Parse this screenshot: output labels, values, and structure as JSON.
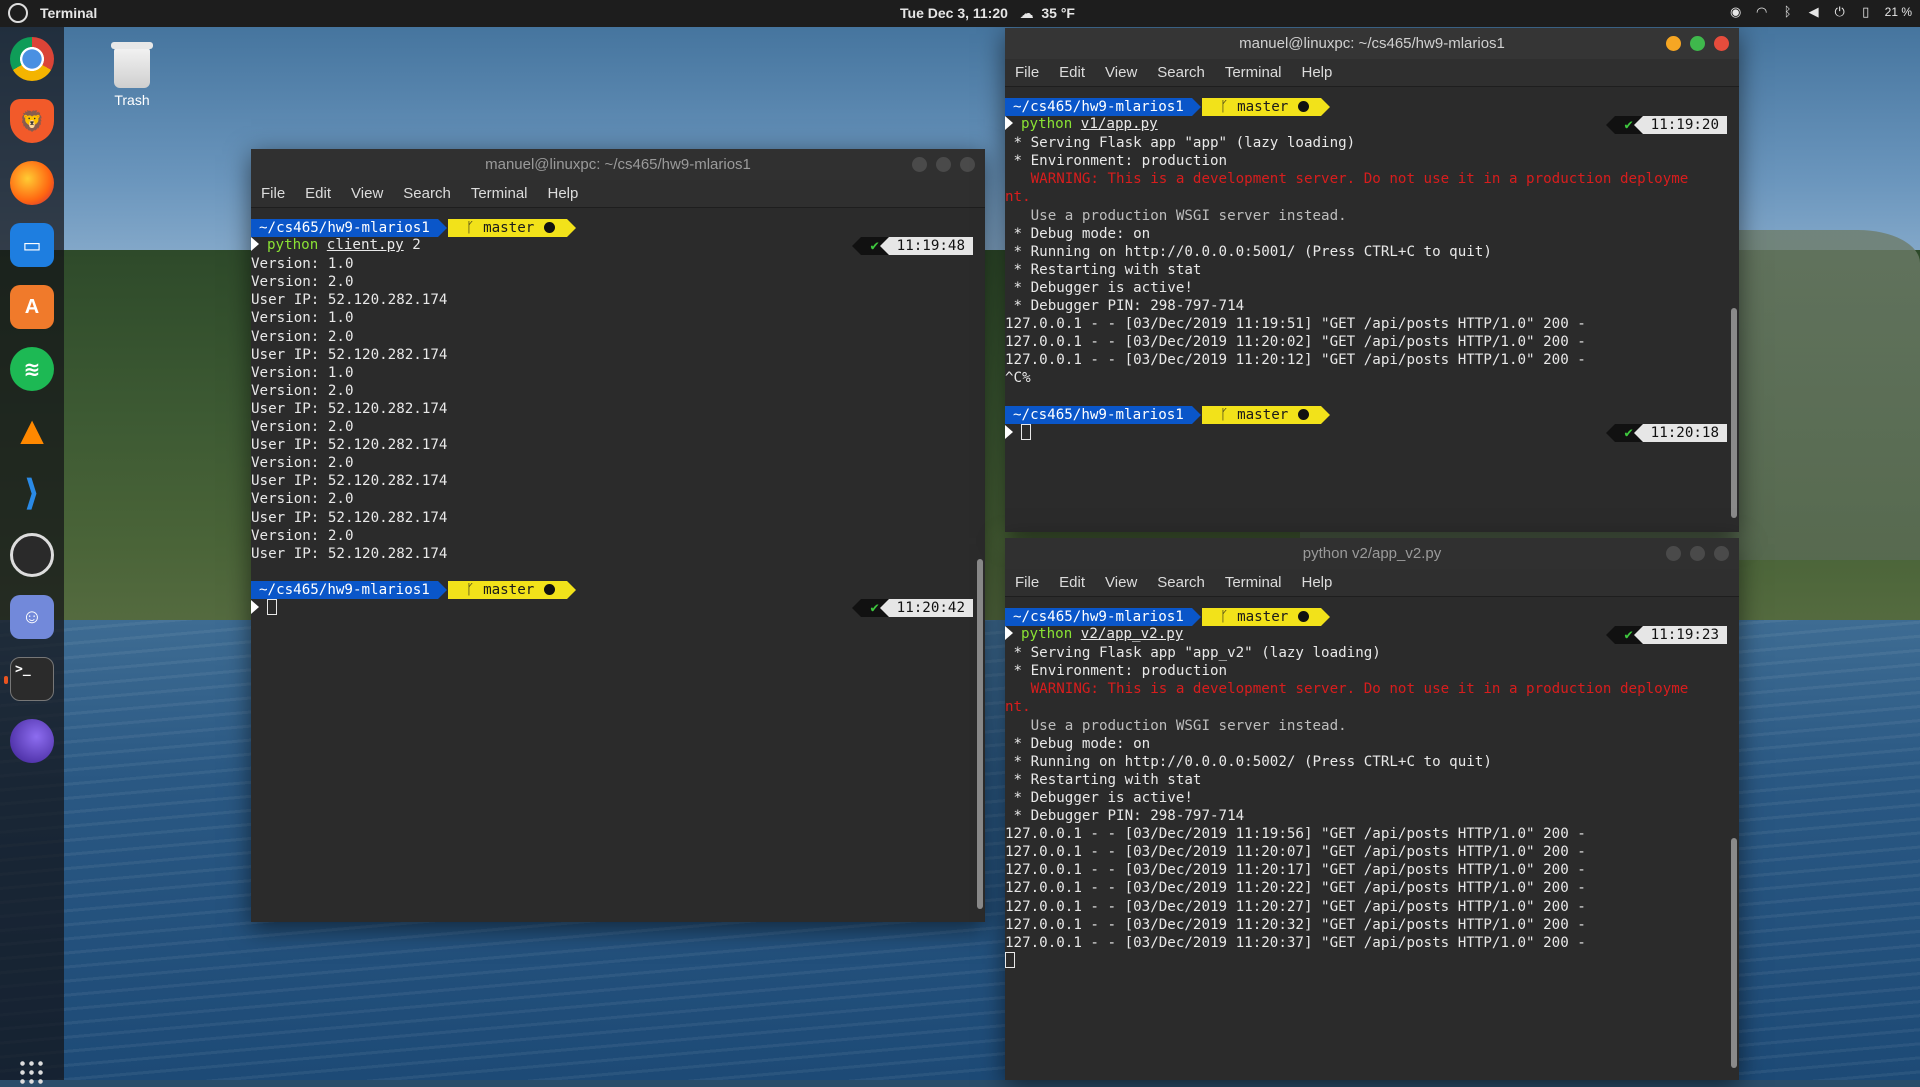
{
  "topbar": {
    "app_name": "Terminal",
    "datetime": "Tue Dec  3, 11:20",
    "weather": "35 °F",
    "battery": "21 %"
  },
  "dock": {
    "items": [
      "Chrome",
      "Brave",
      "Firefox",
      "Files",
      "Software",
      "Spotify",
      "VLC",
      "VS Code",
      "OBS",
      "Discord",
      "Terminal",
      "Stacer"
    ]
  },
  "desktop": {
    "trash_label": "Trash"
  },
  "menu": [
    "File",
    "Edit",
    "View",
    "Search",
    "Terminal",
    "Help"
  ],
  "win1": {
    "title": "manuel@linuxpc: ~/cs465/hw9-mlarios1",
    "prompt1": {
      "dir": "~/cs465/hw9-mlarios1",
      "branch": "master",
      "cmd": "python",
      "arg": "client.py",
      "rest": " 2",
      "time": "11:19:48"
    },
    "output": [
      "Version: 1.0",
      "Version: 2.0",
      "User IP: 52.120.282.174",
      "Version: 1.0",
      "Version: 2.0",
      "User IP: 52.120.282.174",
      "Version: 1.0",
      "Version: 2.0",
      "User IP: 52.120.282.174",
      "Version: 2.0",
      "User IP: 52.120.282.174",
      "Version: 2.0",
      "User IP: 52.120.282.174",
      "Version: 2.0",
      "User IP: 52.120.282.174",
      "Version: 2.0",
      "User IP: 52.120.282.174"
    ],
    "prompt2": {
      "dir": "~/cs465/hw9-mlarios1",
      "branch": "master",
      "time": "11:20:42"
    }
  },
  "win2": {
    "title": "manuel@linuxpc: ~/cs465/hw9-mlarios1",
    "prompt1": {
      "dir": "~/cs465/hw9-mlarios1",
      "branch": "master",
      "cmd": "python",
      "arg": "v1/app.py",
      "time": "11:19:20"
    },
    "output": [
      {
        "t": " * Serving Flask app \"app\" (lazy loading)",
        "c": ""
      },
      {
        "t": " * Environment: production",
        "c": ""
      },
      {
        "t": "   WARNING: This is a development server. Do not use it in a production deployme",
        "c": "warn"
      },
      {
        "t": "nt.",
        "c": "warn"
      },
      {
        "t": "   Use a production WSGI server instead.",
        "c": "dim"
      },
      {
        "t": " * Debug mode: on",
        "c": ""
      },
      {
        "t": " * Running on http://0.0.0.0:5001/ (Press CTRL+C to quit)",
        "c": ""
      },
      {
        "t": " * Restarting with stat",
        "c": ""
      },
      {
        "t": " * Debugger is active!",
        "c": ""
      },
      {
        "t": " * Debugger PIN: 298-797-714",
        "c": ""
      },
      {
        "t": "127.0.0.1 - - [03/Dec/2019 11:19:51] \"GET /api/posts HTTP/1.0\" 200 -",
        "c": ""
      },
      {
        "t": "127.0.0.1 - - [03/Dec/2019 11:20:02] \"GET /api/posts HTTP/1.0\" 200 -",
        "c": ""
      },
      {
        "t": "127.0.0.1 - - [03/Dec/2019 11:20:12] \"GET /api/posts HTTP/1.0\" 200 -",
        "c": ""
      },
      {
        "t": "^C%",
        "c": ""
      }
    ],
    "prompt2": {
      "dir": "~/cs465/hw9-mlarios1",
      "branch": "master",
      "time": "11:20:18"
    }
  },
  "win3": {
    "title": "python v2/app_v2.py",
    "prompt1": {
      "dir": "~/cs465/hw9-mlarios1",
      "branch": "master",
      "cmd": "python",
      "arg": "v2/app_v2.py",
      "time": "11:19:23"
    },
    "output": [
      {
        "t": " * Serving Flask app \"app_v2\" (lazy loading)",
        "c": ""
      },
      {
        "t": " * Environment: production",
        "c": ""
      },
      {
        "t": "   WARNING: This is a development server. Do not use it in a production deployme",
        "c": "warn"
      },
      {
        "t": "nt.",
        "c": "warn"
      },
      {
        "t": "   Use a production WSGI server instead.",
        "c": "dim"
      },
      {
        "t": " * Debug mode: on",
        "c": ""
      },
      {
        "t": " * Running on http://0.0.0.0:5002/ (Press CTRL+C to quit)",
        "c": ""
      },
      {
        "t": " * Restarting with stat",
        "c": ""
      },
      {
        "t": " * Debugger is active!",
        "c": ""
      },
      {
        "t": " * Debugger PIN: 298-797-714",
        "c": ""
      },
      {
        "t": "127.0.0.1 - - [03/Dec/2019 11:19:56] \"GET /api/posts HTTP/1.0\" 200 -",
        "c": ""
      },
      {
        "t": "127.0.0.1 - - [03/Dec/2019 11:20:07] \"GET /api/posts HTTP/1.0\" 200 -",
        "c": ""
      },
      {
        "t": "127.0.0.1 - - [03/Dec/2019 11:20:17] \"GET /api/posts HTTP/1.0\" 200 -",
        "c": ""
      },
      {
        "t": "127.0.0.1 - - [03/Dec/2019 11:20:22] \"GET /api/posts HTTP/1.0\" 200 -",
        "c": ""
      },
      {
        "t": "127.0.0.1 - - [03/Dec/2019 11:20:27] \"GET /api/posts HTTP/1.0\" 200 -",
        "c": ""
      },
      {
        "t": "127.0.0.1 - - [03/Dec/2019 11:20:32] \"GET /api/posts HTTP/1.0\" 200 -",
        "c": ""
      },
      {
        "t": "127.0.0.1 - - [03/Dec/2019 11:20:37] \"GET /api/posts HTTP/1.0\" 200 -",
        "c": ""
      }
    ]
  }
}
